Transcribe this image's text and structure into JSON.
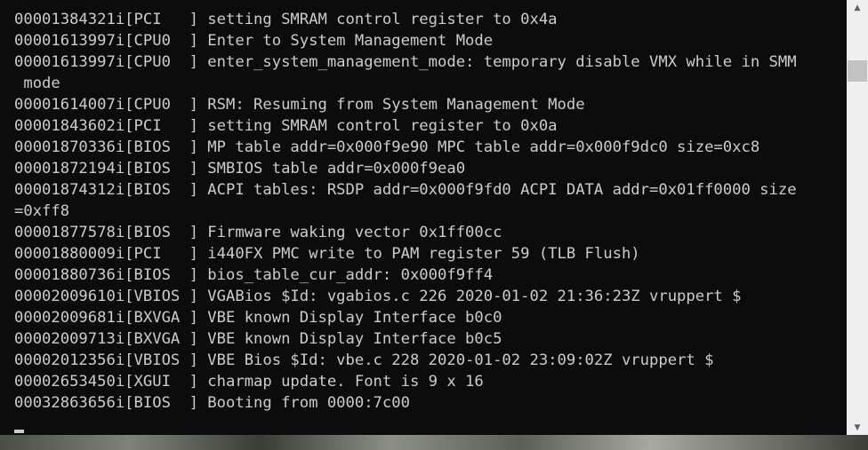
{
  "console": {
    "lines": [
      "00001384321i[PCI   ] setting SMRAM control register to 0x4a",
      "00001613997i[CPU0  ] Enter to System Management Mode",
      "00001613997i[CPU0  ] enter_system_management_mode: temporary disable VMX while in SMM",
      " mode",
      "00001614007i[CPU0  ] RSM: Resuming from System Management Mode",
      "00001843602i[PCI   ] setting SMRAM control register to 0x0a",
      "00001870336i[BIOS  ] MP table addr=0x000f9e90 MPC table addr=0x000f9dc0 size=0xc8",
      "00001872194i[BIOS  ] SMBIOS table addr=0x000f9ea0",
      "00001874312i[BIOS  ] ACPI tables: RSDP addr=0x000f9fd0 ACPI DATA addr=0x01ff0000 size",
      "=0xff8",
      "00001877578i[BIOS  ] Firmware waking vector 0x1ff00cc",
      "00001880009i[PCI   ] i440FX PMC write to PAM register 59 (TLB Flush)",
      "00001880736i[BIOS  ] bios_table_cur_addr: 0x000f9ff4",
      "00002009610i[VBIOS ] VGABios $Id: vgabios.c 226 2020-01-02 21:36:23Z vruppert $",
      "00002009681i[BXVGA ] VBE known Display Interface b0c0",
      "00002009713i[BXVGA ] VBE known Display Interface b0c5",
      "00002012356i[VBIOS ] VBE Bios $Id: vbe.c 228 2020-01-02 23:09:02Z vruppert $",
      "00002653450i[XGUI  ] charmap update. Font is 9 x 16",
      "00032863656i[BIOS  ] Booting from 0000:7c00"
    ]
  },
  "scrollbar": {
    "up_icon": "scroll-up-arrow-icon",
    "down_icon": "scroll-down-arrow-icon",
    "up_glyph": "▲",
    "down_glyph": "▼"
  },
  "colors": {
    "background": "#0c0c0c",
    "text": "#cccccc",
    "scrollbar_track": "#f0f0f0",
    "scrollbar_thumb": "#c2c2c2"
  }
}
